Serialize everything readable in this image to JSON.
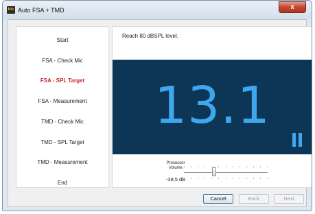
{
  "window": {
    "title": "Auto FSA + TMD",
    "app_icon_text": "bic",
    "close_label": "x"
  },
  "steps": [
    {
      "label": "Start",
      "active": false
    },
    {
      "label": "FSA - Check Mic",
      "active": false
    },
    {
      "label": "FSA - SPL Target",
      "active": true
    },
    {
      "label": "FSA - Measurement",
      "active": false
    },
    {
      "label": "TMD - Check Mic",
      "active": false
    },
    {
      "label": "TMD - SPL Target",
      "active": false
    },
    {
      "label": "TMD - Measurement",
      "active": false
    },
    {
      "label": "End",
      "active": false
    }
  ],
  "main": {
    "instruction": "Reach 80 dBSPL level.",
    "display_value": "13.1",
    "pause_icon": "pause-icon"
  },
  "volume": {
    "label_line1": "Processor",
    "label_line2": "Volume",
    "value": "-39,5 dB",
    "slider_fraction": 0.35
  },
  "buttons": {
    "cancel": "Cancel",
    "back": "Back",
    "next": "Next"
  },
  "colors": {
    "display_background": "#0d3556",
    "display_number": "#3ea7ee",
    "active_step": "#c8242b"
  }
}
